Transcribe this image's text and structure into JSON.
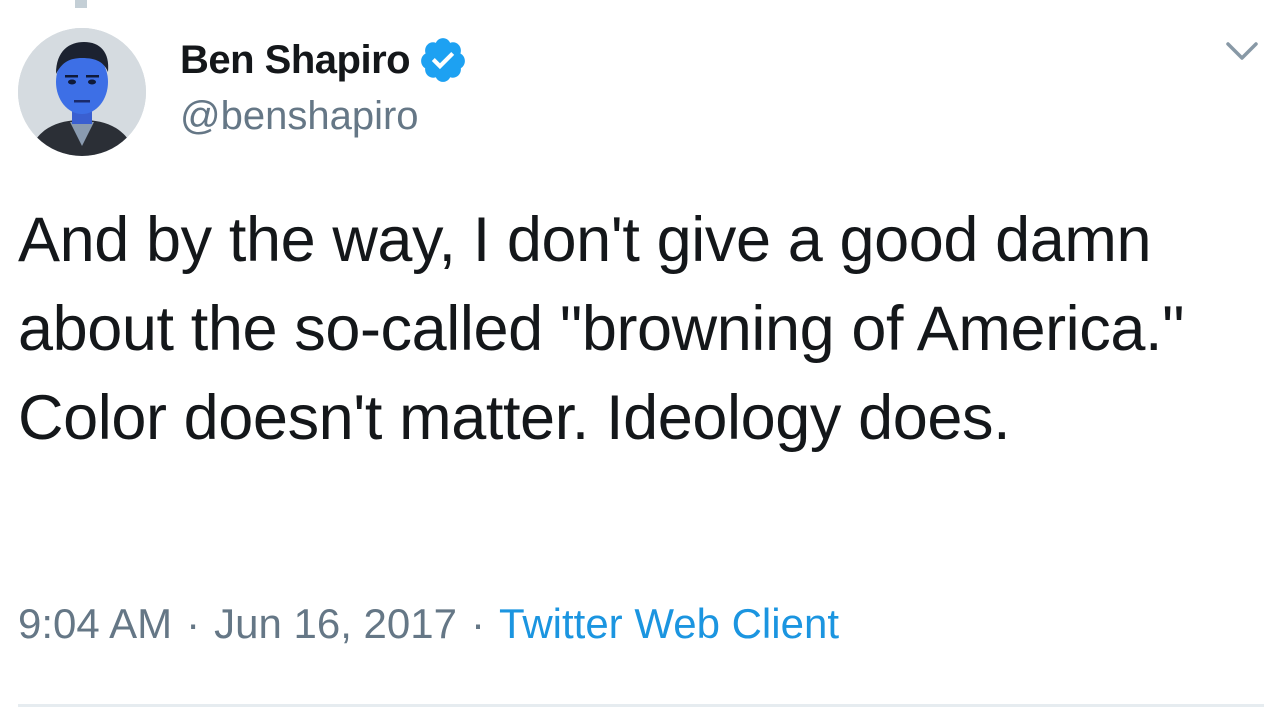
{
  "tweet": {
    "author": {
      "display_name": "Ben Shapiro",
      "handle": "@benshapiro",
      "verified": true
    },
    "text": "And by the way, I don't give a good damn about the so-called \"browning of America.\" Color doesn't matter. Ideology does.",
    "time": "9:04 AM",
    "separator": "·",
    "date": "Jun 16, 2017",
    "source": "Twitter Web Client"
  },
  "icons": {
    "verified": "verified-badge-icon",
    "menu": "chevron-down-icon"
  },
  "colors": {
    "text": "#14171a",
    "secondary": "#657786",
    "link": "#1b95e0",
    "verified": "#1da1f2",
    "divider": "#e6ecf0"
  }
}
